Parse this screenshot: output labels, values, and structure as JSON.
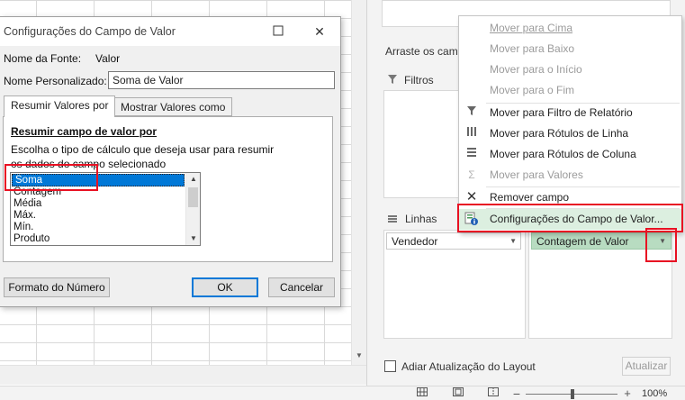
{
  "dialog": {
    "title": "Configurações do Campo de Valor",
    "source_label": "Nome da Fonte:",
    "source_value": "Valor",
    "custom_name_label": "Nome Personalizado:",
    "custom_name_value": "Soma de Valor",
    "tabs": [
      {
        "label": "Resumir Valores por",
        "active": true
      },
      {
        "label": "Mostrar Valores como",
        "active": false
      }
    ],
    "section_title": "Resumir campo de valor por",
    "description_line1": "Escolha o tipo de cálculo que deseja usar para resumir",
    "description_line2": "os dados do campo selecionado",
    "functions": [
      "Soma",
      "Contagem",
      "Média",
      "Máx.",
      "Mín.",
      "Produto"
    ],
    "selected_function": "Soma",
    "number_format_button": "Formato do Número",
    "ok_button": "OK",
    "cancel_button": "Cancelar"
  },
  "pane": {
    "drag_label": "Arraste os camp",
    "filters_label": "Filtros",
    "rows_label": "Linhas",
    "row_field": "Vendedor",
    "value_field": "Contagem de Valor",
    "defer_update_label": "Adiar Atualização do Layout",
    "update_button": "Atualizar"
  },
  "context_menu": {
    "items": [
      {
        "label": "Mover para Cima",
        "enabled": false,
        "icon": ""
      },
      {
        "label": "Mover para Baixo",
        "enabled": false,
        "icon": ""
      },
      {
        "label": "Mover para o Início",
        "enabled": false,
        "icon": ""
      },
      {
        "label": "Mover para o Fim",
        "enabled": false,
        "icon": ""
      },
      {
        "label": "Mover para Filtro de Relatório",
        "enabled": true,
        "icon": "filter-icon"
      },
      {
        "label": "Mover para Rótulos de Linha",
        "enabled": true,
        "icon": "rows-icon"
      },
      {
        "label": "Mover para Rótulos de Coluna",
        "enabled": true,
        "icon": "columns-icon"
      },
      {
        "label": "Mover para Valores",
        "enabled": false,
        "icon": "sigma-icon"
      },
      {
        "label": "Remover campo",
        "enabled": true,
        "icon": "remove-icon"
      },
      {
        "label": "Configurações do Campo de Valor...",
        "enabled": true,
        "icon": "field-settings-icon",
        "highlighted": true
      }
    ]
  },
  "status_bar": {
    "zoom": "100%"
  },
  "colors": {
    "selection_blue": "#0078d7",
    "highlight_red": "#e81123",
    "value_field_green": "#b8dcc1",
    "menu_highlight": "#dcefe0"
  }
}
